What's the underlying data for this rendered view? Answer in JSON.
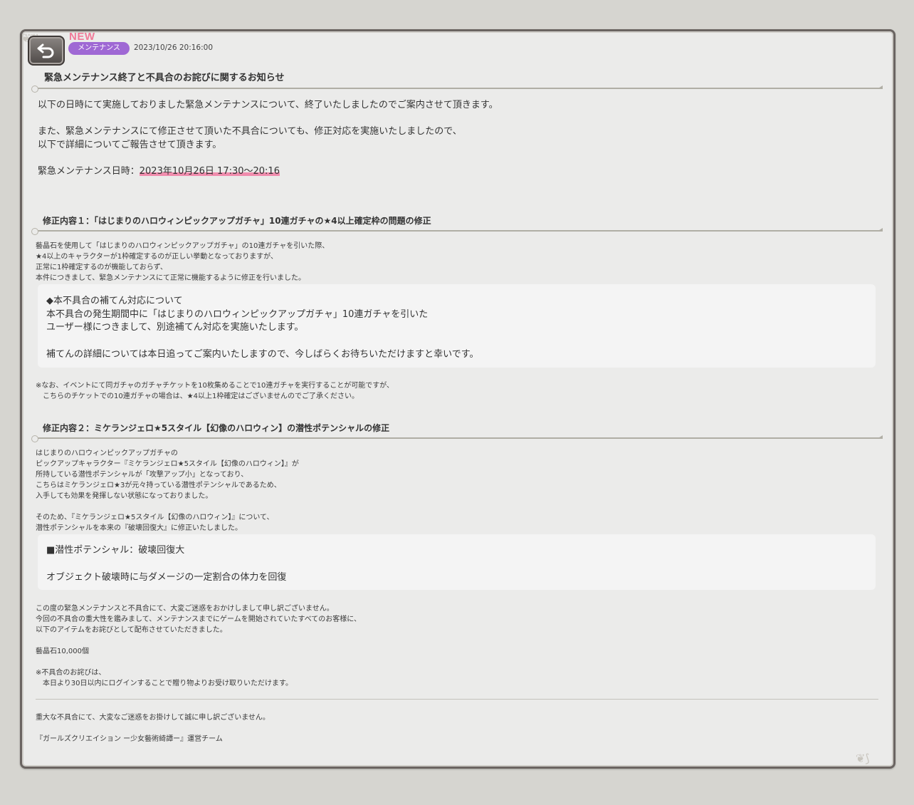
{
  "header": {
    "new_label": "NEW",
    "category": "メンテナンス",
    "datetime": "2023/10/26 20:16:00",
    "title": "緊急メンテナンス終了と不具合のお詫びに関するお知らせ"
  },
  "intro": {
    "line1": "以下の日時にて実施しておりました緊急メンテナンスについて、終了いたしましたのでご案内させて頂きます。",
    "line2": "また、緊急メンテナンスにて修正させて頂いた不具合についても、修正対応を実施いたしましたので、",
    "line3": "以下で詳細についてご報告させて頂きます。",
    "schedule_label": "緊急メンテナンス日時：",
    "schedule_value": "2023年10月26日 17:30〜20:16"
  },
  "fix1": {
    "heading": "修正内容１：「はじまりのハロウィンピックアップガチャ」10連ガチャの★4以上確定枠の問題の修正",
    "lines": [
      "藝晶石を使用して「はじまりのハロウィンピックアップガチャ」の10連ガチャを引いた際、",
      "★4以上のキャラクターが1枠確定するのが正しい挙動となっておりますが、",
      "正常に1枠確定するのが機能しておらず、",
      "本件につきまして、緊急メンテナンスにて正常に機能するように修正を行いました。"
    ],
    "box_lines": [
      "◆本不具合の補てん対応について",
      "本不具合の発生期間中に「はじまりのハロウィンピックアップガチャ」10連ガチャを引いた",
      "ユーザー様につきまして、別途補てん対応を実施いたします。",
      "補てんの詳細については本日追ってご案内いたしますので、今しばらくお待ちいただけますと幸いです。"
    ],
    "notes": [
      "※なお、イベントにて同ガチャのガチャチケットを10枚集めることで10連ガチャを実行することが可能ですが、",
      "　こちらのチケットでの10連ガチャの場合は、★4以上1枠確定はございませんのでご了承ください。"
    ]
  },
  "fix2": {
    "heading": "修正内容２：ミケランジェロ★5スタイル【幻像のハロウィン】の潜性ポテンシャルの修正",
    "lines": [
      "はじまりのハロウィンピックアップガチャの",
      "ピックアップキャラクター『ミケランジェロ★5スタイル【幻像のハロウィン】』が",
      "所持している潜性ポテンシャルが「攻撃アップ小」となっており、",
      "こちらはミケランジェロ★3が元々持っている潜性ポテンシャルであるため、",
      "入手しても効果を発揮しない状態になっておりました。",
      "そのため、『ミケランジェロ★5スタイル【幻像のハロウィン】』について、",
      "潜性ポテンシャルを本来の『破壊回復大』に修正いたしました。"
    ],
    "box_lines": [
      "■潜性ポテンシャル：破壊回復大",
      "オブジェクト破壊時に与ダメージの一定割合の体力を回復"
    ]
  },
  "apology": {
    "lines": [
      "この度の緊急メンテナンスと不具合にて、大変ご迷惑をおかけしまして申し訳ございません。",
      "今回の不具合の重大性を鑑みまして、メンテナンスまでにゲームを開始されていたすべてのお客様に、",
      "以下のアイテムをお詫びとして配布させていただきました。"
    ],
    "item": "藝晶石10,000個",
    "notes": [
      "※不具合のお詫びは、",
      "　本日より30日以内にログインすることで贈り物よりお受け取りいただけます。"
    ]
  },
  "footer": {
    "line1": "重大な不具合にて、大変なご迷惑をお掛けして誠に申し訳ございません。",
    "signature": "『ガールズクリエイション ー少女藝術綺譚ー』運営チーム"
  },
  "colors": {
    "badge": "#9f68d4",
    "new": "#f07a98",
    "highlight": "#f08cad"
  }
}
